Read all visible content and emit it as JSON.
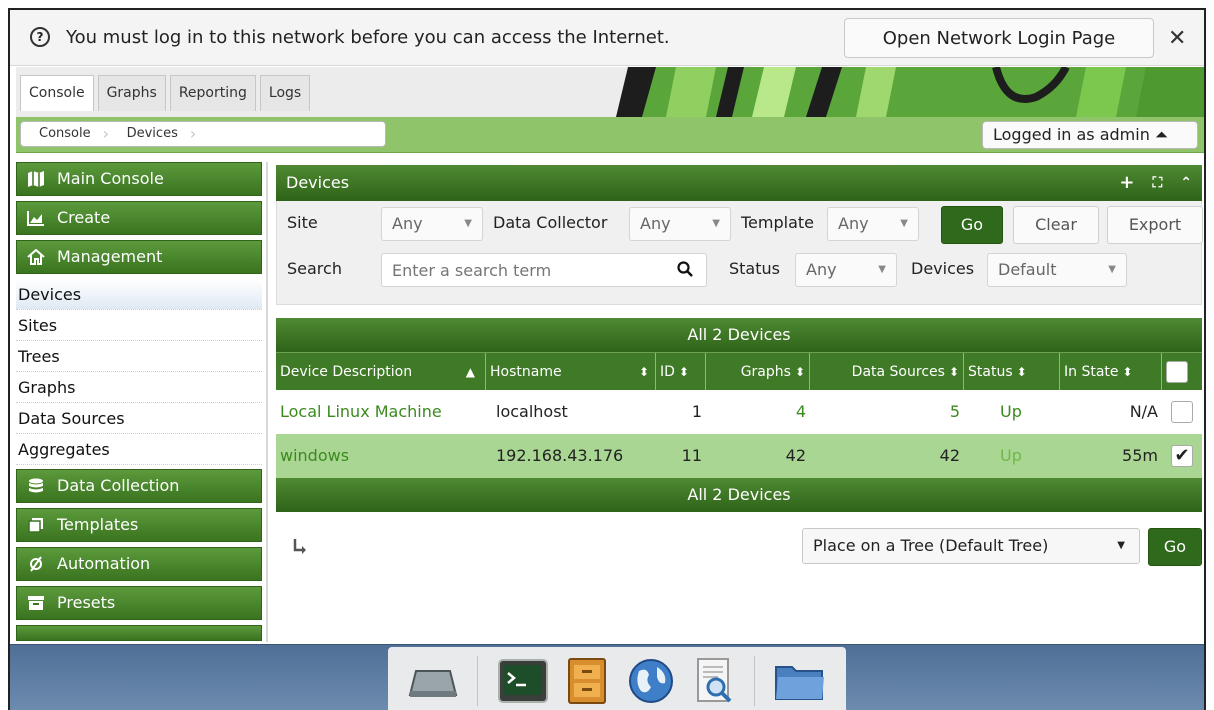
{
  "notification": {
    "message": "You must log in to this network before you can access the Internet.",
    "button_label": "Open Network Login Page",
    "close_glyph": "✕",
    "help_glyph": "?"
  },
  "tabs": [
    "Console",
    "Graphs",
    "Reporting",
    "Logs"
  ],
  "breadcrumbs": [
    "Console",
    "Devices"
  ],
  "user_menu": "Logged in as admin ⏶",
  "sidebar": {
    "headers": {
      "main_console": "Main Console",
      "create": "Create",
      "management": "Management",
      "data_collection": "Data Collection",
      "templates": "Templates",
      "automation": "Automation",
      "presets": "Presets"
    },
    "management_items": [
      "Devices",
      "Sites",
      "Trees",
      "Graphs",
      "Data Sources",
      "Aggregates"
    ]
  },
  "panel": {
    "title": "Devices",
    "filters": {
      "site_label": "Site",
      "site_value": "Any",
      "collector_label": "Data Collector",
      "collector_value": "Any",
      "template_label": "Template",
      "template_value": "Any",
      "go": "Go",
      "clear": "Clear",
      "export": "Export",
      "search_label": "Search",
      "search_placeholder": "Enter a search term",
      "status_label": "Status",
      "status_value": "Any",
      "devices_label": "Devices",
      "devices_value": "Default"
    }
  },
  "table": {
    "caption": "All 2 Devices",
    "columns": [
      "Device Description",
      "Hostname",
      "ID",
      "Graphs",
      "Data Sources",
      "Status",
      "In State"
    ],
    "rows": [
      {
        "description": "Local Linux Machine",
        "hostname": "localhost",
        "id": "1",
        "graphs": "4",
        "data_sources": "5",
        "status": "Up",
        "in_state": "N/A",
        "checked": ""
      },
      {
        "description": "windows",
        "hostname": "192.168.43.176",
        "id": "11",
        "graphs": "42",
        "data_sources": "42",
        "status": "Up",
        "in_state": "55m",
        "checked": "✔"
      }
    ],
    "footer_caption": "All 2 Devices"
  },
  "actions": {
    "tree_select": "Place on a Tree (Default Tree)",
    "go": "Go"
  },
  "colors": {
    "header_green": "#3f7a27",
    "accent_green": "#3c8a1f",
    "selected_row": "#a9d693"
  },
  "dock_icons": [
    "drive-icon",
    "terminal-icon",
    "file-cabinet-icon",
    "globe-icon",
    "document-search-icon",
    "folder-icon"
  ]
}
